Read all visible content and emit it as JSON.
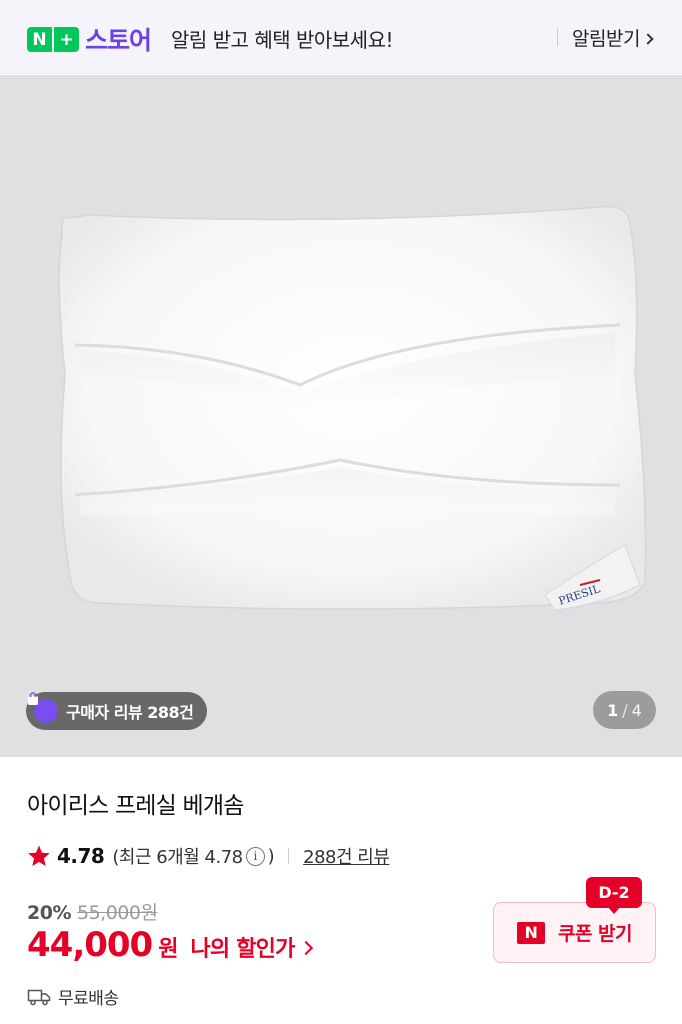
{
  "banner": {
    "logo_n": "N",
    "logo_plus": "+",
    "store_name": "스토어",
    "message": "알림 받고 혜택 받아보세요!",
    "cta_label": "알림받기"
  },
  "gallery": {
    "review_badge": "구매자 리뷰 288건",
    "page_current": "1",
    "page_separator": "/",
    "page_total": "4",
    "label_brand": "PRESIL"
  },
  "product": {
    "title": "아이리스 프레실 베개솜",
    "rating": "4.78",
    "recent_rating_prefix": "(최근 6개월 4.78",
    "recent_rating_suffix": ")",
    "review_count_link": "288건 리뷰",
    "discount_rate": "20%",
    "original_price": "55,000원",
    "sale_price": "44,000",
    "currency": "원",
    "my_price_link": "나의 할인가",
    "shipping": "무료배송"
  },
  "coupon": {
    "badge": "N",
    "label": "쿠폰 받기",
    "dday": "D-2"
  },
  "colors": {
    "brand_green": "#03c75a",
    "store_purple": "#6a42e8",
    "accent_red": "#e50027",
    "star_red": "#e50027"
  }
}
